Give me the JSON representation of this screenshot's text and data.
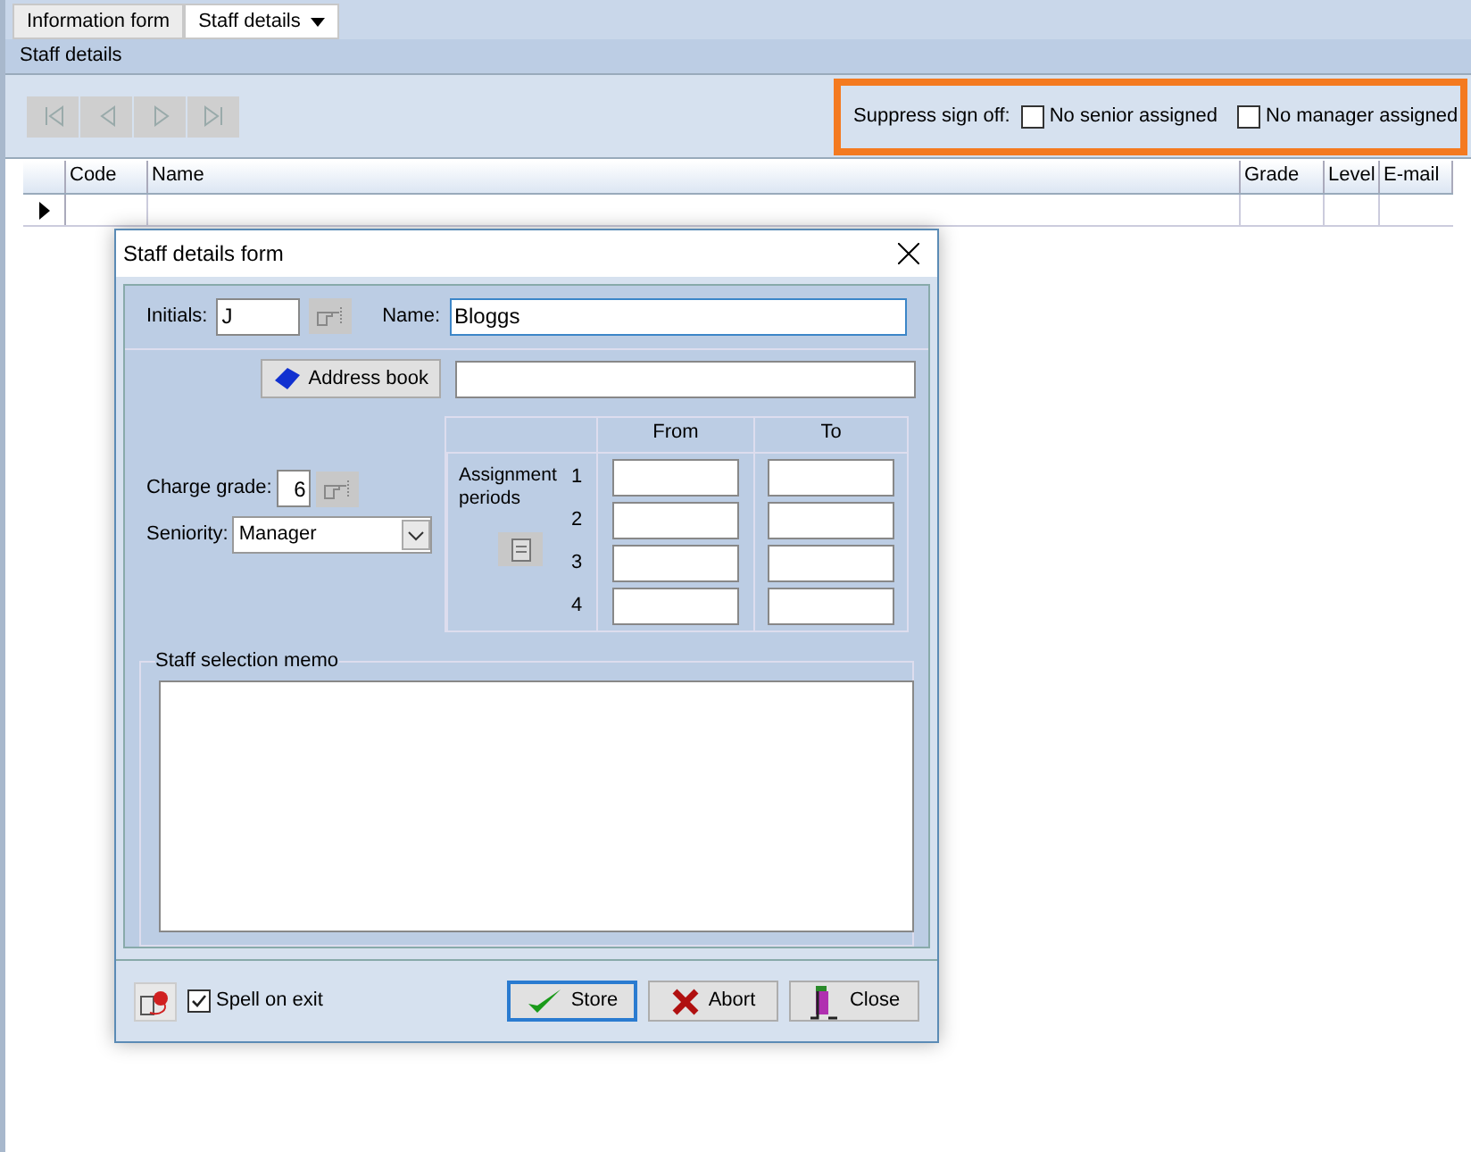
{
  "tabs": [
    {
      "label": "Information form",
      "selected": false,
      "dropdown": false
    },
    {
      "label": "Staff details",
      "selected": true,
      "dropdown": true
    }
  ],
  "panel": {
    "title": "Staff details"
  },
  "nav_buttons": [
    {
      "kind": "first",
      "disabled": true
    },
    {
      "kind": "prev",
      "disabled": true
    },
    {
      "kind": "next",
      "disabled": true
    },
    {
      "kind": "last",
      "disabled": true
    }
  ],
  "suppress": {
    "label": "Suppress sign off:",
    "options": [
      {
        "label": "No senior assigned",
        "checked": false
      },
      {
        "label": "No manager assigned",
        "checked": false
      }
    ]
  },
  "table": {
    "columns": [
      "Code",
      "Name",
      "Grade",
      "Level",
      "E-mail"
    ]
  },
  "dialog": {
    "title": "Staff details form",
    "initials": {
      "label": "Initials:",
      "value": "J"
    },
    "name": {
      "label": "Name:",
      "value": "Bloggs"
    },
    "address_book": {
      "label": "Address book"
    },
    "charge_grade": {
      "label": "Charge grade:",
      "value": "6"
    },
    "seniority": {
      "label": "Seniority:",
      "value": "Manager"
    },
    "periods": {
      "label": "Assignment periods",
      "from": "From",
      "to": "To",
      "rows": [
        "1",
        "2",
        "3",
        "4"
      ]
    },
    "memo": {
      "label": "Staff selection memo"
    },
    "spell": {
      "label": "Spell on exit",
      "checked": true
    },
    "buttons": [
      {
        "kind": "store",
        "label": "Store",
        "default": true
      },
      {
        "kind": "abort",
        "label": "Abort",
        "default": false
      },
      {
        "kind": "close",
        "label": "Close",
        "default": false
      }
    ]
  }
}
